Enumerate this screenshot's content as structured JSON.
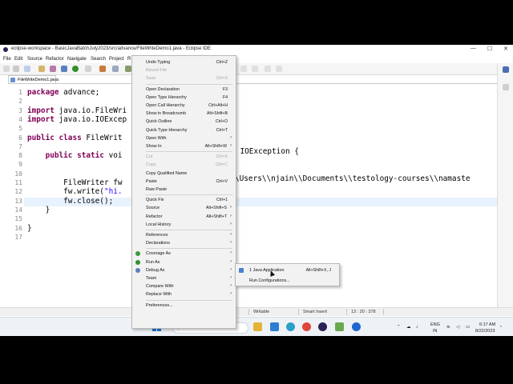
{
  "window": {
    "title": "eclipse-workspace - BasicJavaBatchJuly2023/src/advance/FileWriteDemo1.java - Eclipse IDE",
    "controls": [
      "—",
      "☐",
      "✕"
    ]
  },
  "menubar": [
    {
      "label": "File",
      "u": "F"
    },
    {
      "label": "Edit",
      "u": "E"
    },
    {
      "label": "Source",
      "u": "S"
    },
    {
      "label": "Refactor",
      "u": "R"
    },
    {
      "label": "Navigate",
      "u": "N"
    },
    {
      "label": "Search",
      "u": "S"
    },
    {
      "label": "Project",
      "u": "P"
    },
    {
      "label": "R",
      "u": "R"
    }
  ],
  "editor": {
    "tab_label": "FileWriteDemo1.java",
    "line_numbers": [
      "1",
      "2",
      "3",
      "4",
      "5",
      "6",
      "7",
      "8",
      "9",
      "10",
      "11",
      "12",
      "13",
      "14",
      "15",
      "16",
      "17"
    ],
    "lines": [
      {
        "n": "1",
        "segments": [
          {
            "t": "package",
            "c": "kw"
          },
          {
            "t": " advance;",
            "c": ""
          }
        ]
      },
      {
        "n": "2",
        "segments": []
      },
      {
        "n": "3",
        "segments": [
          {
            "t": "import",
            "c": "kw"
          },
          {
            "t": " java.io.FileWri",
            "c": ""
          }
        ]
      },
      {
        "n": "4",
        "segments": [
          {
            "t": "import",
            "c": "kw"
          },
          {
            "t": " java.io.IOExcep",
            "c": ""
          }
        ]
      },
      {
        "n": "5",
        "segments": []
      },
      {
        "n": "6",
        "segments": [
          {
            "t": "public class",
            "c": "kw"
          },
          {
            "t": " FileWrit",
            "c": ""
          }
        ]
      },
      {
        "n": "7",
        "segments": []
      },
      {
        "n": "8",
        "segments": [
          {
            "t": "    ",
            "c": ""
          },
          {
            "t": "public static",
            "c": "kw"
          },
          {
            "t": " voi",
            "c": ""
          }
        ]
      },
      {
        "n": "9",
        "segments": []
      },
      {
        "n": "10",
        "segments": []
      },
      {
        "n": "11",
        "segments": [
          {
            "t": "        FileWriter fw",
            "c": ""
          }
        ]
      },
      {
        "n": "12",
        "segments": [
          {
            "t": "        fw.write(",
            "c": ""
          },
          {
            "t": "\"hi.",
            "c": "str"
          }
        ]
      },
      {
        "n": "13",
        "segments": [
          {
            "t": "        fw.close();",
            "c": ""
          }
        ]
      },
      {
        "n": "14",
        "segments": [
          {
            "t": "    }",
            "c": ""
          }
        ]
      },
      {
        "n": "15",
        "segments": []
      },
      {
        "n": "16",
        "segments": [
          {
            "t": "}",
            "c": ""
          }
        ]
      },
      {
        "n": "17",
        "segments": []
      }
    ],
    "tail_line8_kw": "throws",
    "tail_line8_rest": " IOException {",
    "tail_line11": "\\Users\\\\njain\\\\Documents\\\\testology-courses\\\\namaste"
  },
  "context_menu": {
    "items": [
      {
        "label": "Undo Typing",
        "acc": "Ctrl+Z",
        "dis": false,
        "sub": false
      },
      {
        "label": "Revert File",
        "acc": "",
        "dis": true,
        "sub": false
      },
      {
        "label": "Save",
        "acc": "Ctrl+S",
        "dis": true,
        "sub": false
      },
      {
        "sep": true
      },
      {
        "label": "Open Declaration",
        "acc": "F3",
        "dis": false,
        "sub": false
      },
      {
        "label": "Open Type Hierarchy",
        "acc": "F4",
        "dis": false,
        "sub": false
      },
      {
        "label": "Open Call Hierarchy",
        "acc": "Ctrl+Alt+H",
        "dis": false,
        "sub": false
      },
      {
        "label": "Show in Breadcrumb",
        "acc": "Alt+Shift+B",
        "dis": false,
        "sub": false
      },
      {
        "label": "Quick Outline",
        "acc": "Ctrl+O",
        "dis": false,
        "sub": false
      },
      {
        "label": "Quick Type Hierarchy",
        "acc": "Ctrl+T",
        "dis": false,
        "sub": false
      },
      {
        "label": "Open With",
        "acc": "",
        "dis": false,
        "sub": true
      },
      {
        "label": "Show In",
        "acc": "Alt+Shift+W",
        "dis": false,
        "sub": true
      },
      {
        "sep": true
      },
      {
        "label": "Cut",
        "acc": "Ctrl+X",
        "dis": true,
        "sub": false
      },
      {
        "label": "Copy",
        "acc": "Ctrl+C",
        "dis": true,
        "sub": false
      },
      {
        "label": "Copy Qualified Name",
        "acc": "",
        "dis": false,
        "sub": false
      },
      {
        "label": "Paste",
        "acc": "Ctrl+V",
        "dis": false,
        "sub": false
      },
      {
        "label": "Raw Paste",
        "acc": "",
        "dis": false,
        "sub": false
      },
      {
        "sep": true
      },
      {
        "label": "Quick Fix",
        "acc": "Ctrl+1",
        "dis": false,
        "sub": false
      },
      {
        "label": "Source",
        "acc": "Alt+Shift+S",
        "dis": false,
        "sub": true
      },
      {
        "label": "Refactor",
        "acc": "Alt+Shift+T",
        "dis": false,
        "sub": true
      },
      {
        "label": "Local History",
        "acc": "",
        "dis": false,
        "sub": true
      },
      {
        "sep": true
      },
      {
        "label": "References",
        "acc": "",
        "dis": false,
        "sub": true
      },
      {
        "label": "Declarations",
        "acc": "",
        "dis": false,
        "sub": true
      },
      {
        "sep": true
      },
      {
        "label": "Coverage As",
        "acc": "",
        "dis": false,
        "sub": true,
        "icon": "#3a9a3a"
      },
      {
        "label": "Run As",
        "acc": "",
        "dis": false,
        "sub": true,
        "icon": "#2f8f2f"
      },
      {
        "label": "Debug As",
        "acc": "",
        "dis": false,
        "sub": true,
        "icon": "#5a7fbf"
      },
      {
        "label": "Team",
        "acc": "",
        "dis": false,
        "sub": true
      },
      {
        "label": "Compare With",
        "acc": "",
        "dis": false,
        "sub": true
      },
      {
        "label": "Replace With",
        "acc": "",
        "dis": false,
        "sub": true
      },
      {
        "sep": true
      },
      {
        "label": "Preferences...",
        "acc": "",
        "dis": false,
        "sub": false
      }
    ]
  },
  "submenu": {
    "items": [
      {
        "label": "1 Java Application",
        "acc": "Alt+Shift+X, J"
      },
      {
        "label": "Run Configurations...",
        "acc": ""
      }
    ]
  },
  "statusbar": {
    "writable": "Writable",
    "insert_mode": "Smart Insert",
    "position": "13 : 20 : 378"
  },
  "taskbar": {
    "search_label": "Search",
    "search_icon": "search-icon",
    "tray": {
      "language": "ENG",
      "region": "IN",
      "time": "6:17 AM",
      "date": "8/22/2023"
    }
  }
}
